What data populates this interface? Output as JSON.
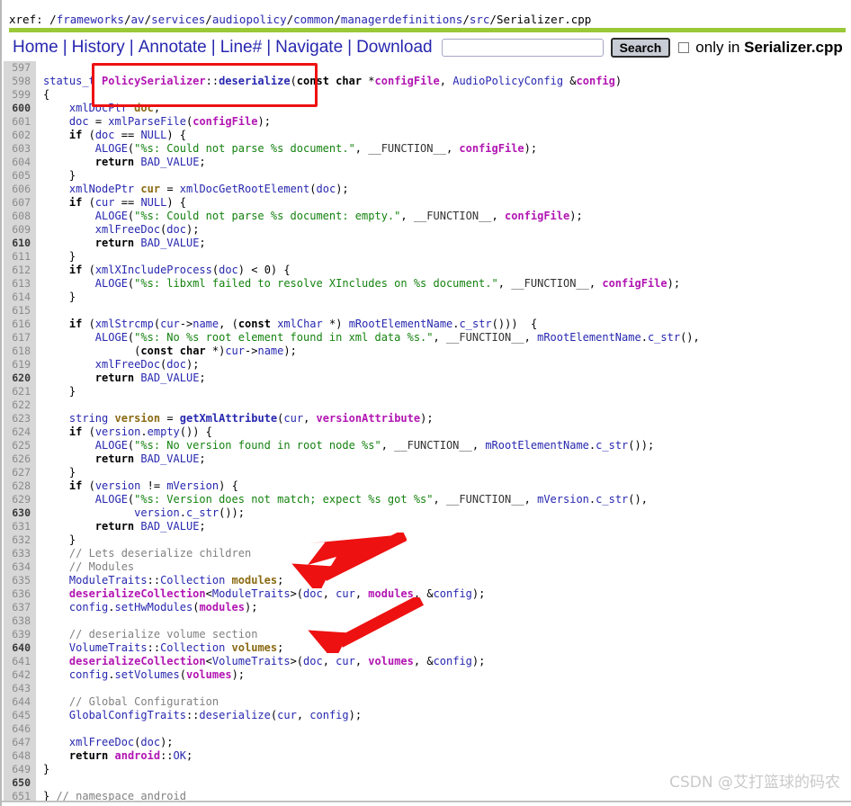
{
  "xref": {
    "label": "xref:",
    "segments": [
      {
        "text": "frameworks",
        "link": true
      },
      {
        "text": "av",
        "link": true
      },
      {
        "text": "services",
        "link": true
      },
      {
        "text": "audiopolicy",
        "link": true
      },
      {
        "text": "common",
        "link": true
      },
      {
        "text": "managerdefinitions",
        "link": true
      },
      {
        "text": "src",
        "link": true
      },
      {
        "text": "Serializer.cpp",
        "link": false
      }
    ]
  },
  "nav": {
    "links": [
      "Home",
      "History",
      "Annotate",
      "Line#",
      "Navigate",
      "Download"
    ],
    "separator": "|",
    "search_value": "",
    "search_placeholder": "",
    "search_button": "Search",
    "checkbox_checked": false,
    "only_in_prefix": "only in ",
    "only_in_file": "Serializer.cpp"
  },
  "colors": {
    "accent_green": "#9ac836",
    "link_blue": "#2727b0",
    "annotation_red": "#ee1111",
    "gutter_bg": "#d7d7d7",
    "string_green": "#14820f",
    "variable_magenta": "#b215b2",
    "decl_brown": "#8a6a12",
    "comment_gray": "#808080"
  },
  "code": {
    "first_line": 597,
    "lines": [
      {
        "n": 597,
        "html": ""
      },
      {
        "n": 598,
        "html": "<span class=\"typ\">status_t</span> <span class=\"cls\">PolicySerializer</span><span class=\"plain\">::</span><span class=\"fn\">deserialize</span><span class=\"plain\">(</span><span class=\"kw\">const char</span> <span class=\"plain\">*</span><span class=\"var\">configFile</span><span class=\"plain\">, </span><span class=\"typ\">AudioPolicyConfig</span> <span class=\"plain\">&amp;</span><span class=\"var\">config</span><span class=\"plain\">)</span>"
      },
      {
        "n": 599,
        "html": "<span class=\"plain\">{</span>"
      },
      {
        "n": 600,
        "html": "    <span class=\"typ\">xmlDocPtr</span> <span class=\"decl\">doc</span><span class=\"plain\">;</span>"
      },
      {
        "n": 601,
        "html": "    <span class=\"typ\">doc</span> <span class=\"plain\">= </span><span class=\"typ\">xmlParseFile</span><span class=\"plain\">(</span><span class=\"var\">configFile</span><span class=\"plain\">);</span>"
      },
      {
        "n": 602,
        "html": "    <span class=\"kw\">if</span> <span class=\"plain\">(</span><span class=\"typ\">doc</span> <span class=\"plain\">== </span><span class=\"typ\">NULL</span><span class=\"plain\">) {</span>"
      },
      {
        "n": 603,
        "html": "        <span class=\"typ\">ALOGE</span><span class=\"plain\">(</span><span class=\"str\">\"%s: Could not parse %s document.\"</span><span class=\"plain\">, </span><span class=\"mac\">__FUNCTION__</span><span class=\"plain\">, </span><span class=\"var\">configFile</span><span class=\"plain\">);</span>"
      },
      {
        "n": 604,
        "html": "        <span class=\"kw\">return</span> <span class=\"typ\">BAD_VALUE</span><span class=\"plain\">;</span>"
      },
      {
        "n": 605,
        "html": "    <span class=\"plain\">}</span>"
      },
      {
        "n": 606,
        "html": "    <span class=\"typ\">xmlNodePtr</span> <span class=\"decl\">cur</span> <span class=\"plain\">= </span><span class=\"typ\">xmlDocGetRootElement</span><span class=\"plain\">(</span><span class=\"typ\">doc</span><span class=\"plain\">);</span>"
      },
      {
        "n": 607,
        "html": "    <span class=\"kw\">if</span> <span class=\"plain\">(</span><span class=\"typ\">cur</span> <span class=\"plain\">== </span><span class=\"typ\">NULL</span><span class=\"plain\">) {</span>"
      },
      {
        "n": 608,
        "html": "        <span class=\"typ\">ALOGE</span><span class=\"plain\">(</span><span class=\"str\">\"%s: Could not parse %s document: empty.\"</span><span class=\"plain\">, </span><span class=\"mac\">__FUNCTION__</span><span class=\"plain\">, </span><span class=\"var\">configFile</span><span class=\"plain\">);</span>"
      },
      {
        "n": 609,
        "html": "        <span class=\"typ\">xmlFreeDoc</span><span class=\"plain\">(</span><span class=\"typ\">doc</span><span class=\"plain\">);</span>"
      },
      {
        "n": 610,
        "html": "        <span class=\"kw\">return</span> <span class=\"typ\">BAD_VALUE</span><span class=\"plain\">;</span>"
      },
      {
        "n": 611,
        "html": "    <span class=\"plain\">}</span>"
      },
      {
        "n": 612,
        "html": "    <span class=\"kw\">if</span> <span class=\"plain\">(</span><span class=\"typ\">xmlXIncludeProcess</span><span class=\"plain\">(</span><span class=\"typ\">doc</span><span class=\"plain\">) &lt; 0) {</span>"
      },
      {
        "n": 613,
        "html": "        <span class=\"typ\">ALOGE</span><span class=\"plain\">(</span><span class=\"str\">\"%s: libxml failed to resolve XIncludes on %s document.\"</span><span class=\"plain\">, </span><span class=\"mac\">__FUNCTION__</span><span class=\"plain\">, </span><span class=\"var\">configFile</span><span class=\"plain\">);</span>"
      },
      {
        "n": 614,
        "html": "    <span class=\"plain\">}</span>"
      },
      {
        "n": 615,
        "html": ""
      },
      {
        "n": 616,
        "html": "    <span class=\"kw\">if</span> <span class=\"plain\">(</span><span class=\"typ\">xmlStrcmp</span><span class=\"plain\">(</span><span class=\"typ\">cur</span><span class=\"plain\">-&gt;</span><span class=\"typ\">name</span><span class=\"plain\">, (</span><span class=\"kw\">const</span> <span class=\"typ\">xmlChar</span> <span class=\"plain\">*) </span><span class=\"typ\">mRootElementName</span><span class=\"plain\">.</span><span class=\"typ\">c_str</span><span class=\"plain\">()))  {</span>"
      },
      {
        "n": 617,
        "html": "        <span class=\"typ\">ALOGE</span><span class=\"plain\">(</span><span class=\"str\">\"%s: No %s root element found in xml data %s.\"</span><span class=\"plain\">, </span><span class=\"mac\">__FUNCTION__</span><span class=\"plain\">, </span><span class=\"typ\">mRootElementName</span><span class=\"plain\">.</span><span class=\"typ\">c_str</span><span class=\"plain\">(),</span>"
      },
      {
        "n": 618,
        "html": "              <span class=\"plain\">(</span><span class=\"kw\">const char</span> <span class=\"plain\">*)</span><span class=\"typ\">cur</span><span class=\"plain\">-&gt;</span><span class=\"typ\">name</span><span class=\"plain\">);</span>"
      },
      {
        "n": 619,
        "html": "        <span class=\"typ\">xmlFreeDoc</span><span class=\"plain\">(</span><span class=\"typ\">doc</span><span class=\"plain\">);</span>"
      },
      {
        "n": 620,
        "html": "        <span class=\"kw\">return</span> <span class=\"typ\">BAD_VALUE</span><span class=\"plain\">;</span>"
      },
      {
        "n": 621,
        "html": "    <span class=\"plain\">}</span>"
      },
      {
        "n": 622,
        "html": ""
      },
      {
        "n": 623,
        "html": "    <span class=\"typ\">string</span> <span class=\"decl\">version</span> <span class=\"plain\">= </span><span class=\"fn\">getXmlAttribute</span><span class=\"plain\">(</span><span class=\"typ\">cur</span><span class=\"plain\">, </span><span class=\"var\">versionAttribute</span><span class=\"plain\">);</span>"
      },
      {
        "n": 624,
        "html": "    <span class=\"kw\">if</span> <span class=\"plain\">(</span><span class=\"typ\">version</span><span class=\"plain\">.</span><span class=\"typ\">empty</span><span class=\"plain\">()) {</span>"
      },
      {
        "n": 625,
        "html": "        <span class=\"typ\">ALOGE</span><span class=\"plain\">(</span><span class=\"str\">\"%s: No version found in root node %s\"</span><span class=\"plain\">, </span><span class=\"mac\">__FUNCTION__</span><span class=\"plain\">, </span><span class=\"typ\">mRootElementName</span><span class=\"plain\">.</span><span class=\"typ\">c_str</span><span class=\"plain\">());</span>"
      },
      {
        "n": 626,
        "html": "        <span class=\"kw\">return</span> <span class=\"typ\">BAD_VALUE</span><span class=\"plain\">;</span>"
      },
      {
        "n": 627,
        "html": "    <span class=\"plain\">}</span>"
      },
      {
        "n": 628,
        "html": "    <span class=\"kw\">if</span> <span class=\"plain\">(</span><span class=\"typ\">version</span> <span class=\"plain\">!= </span><span class=\"typ\">mVersion</span><span class=\"plain\">) {</span>"
      },
      {
        "n": 629,
        "html": "        <span class=\"typ\">ALOGE</span><span class=\"plain\">(</span><span class=\"str\">\"%s: Version does not match; expect %s got %s\"</span><span class=\"plain\">, </span><span class=\"mac\">__FUNCTION__</span><span class=\"plain\">, </span><span class=\"typ\">mVersion</span><span class=\"plain\">.</span><span class=\"typ\">c_str</span><span class=\"plain\">(),</span>"
      },
      {
        "n": 630,
        "html": "              <span class=\"typ\">version</span><span class=\"plain\">.</span><span class=\"typ\">c_str</span><span class=\"plain\">());</span>"
      },
      {
        "n": 631,
        "html": "        <span class=\"kw\">return</span> <span class=\"typ\">BAD_VALUE</span><span class=\"plain\">;</span>"
      },
      {
        "n": 632,
        "html": "    <span class=\"plain\">}</span>"
      },
      {
        "n": 633,
        "html": "    <span class=\"cmt\">// Lets deserialize children</span>"
      },
      {
        "n": 634,
        "html": "    <span class=\"cmt\">// Modules</span>"
      },
      {
        "n": 635,
        "html": "    <span class=\"typ\">ModuleTraits</span><span class=\"plain\">::</span><span class=\"typ\">Collection</span> <span class=\"decl\">modules</span><span class=\"plain\">;</span>"
      },
      {
        "n": 636,
        "html": "    <span class=\"var\">deserializeCollection</span><span class=\"plain\">&lt;</span><span class=\"typ\">ModuleTraits</span><span class=\"plain\">&gt;(</span><span class=\"typ\">doc</span><span class=\"plain\">, </span><span class=\"typ\">cur</span><span class=\"plain\">, </span><span class=\"var\">modules</span><span class=\"plain\">, &amp;</span><span class=\"typ\">config</span><span class=\"plain\">);</span>"
      },
      {
        "n": 637,
        "html": "    <span class=\"typ\">config</span><span class=\"plain\">.</span><span class=\"typ\">setHwModules</span><span class=\"plain\">(</span><span class=\"var\">modules</span><span class=\"plain\">);</span>"
      },
      {
        "n": 638,
        "html": ""
      },
      {
        "n": 639,
        "html": "    <span class=\"cmt\">// deserialize volume section</span>"
      },
      {
        "n": 640,
        "html": "    <span class=\"typ\">VolumeTraits</span><span class=\"plain\">::</span><span class=\"typ\">Collection</span> <span class=\"decl\">volumes</span><span class=\"plain\">;</span>"
      },
      {
        "n": 641,
        "html": "    <span class=\"var\">deserializeCollection</span><span class=\"plain\">&lt;</span><span class=\"typ\">VolumeTraits</span><span class=\"plain\">&gt;(</span><span class=\"typ\">doc</span><span class=\"plain\">, </span><span class=\"typ\">cur</span><span class=\"plain\">, </span><span class=\"var\">volumes</span><span class=\"plain\">, &amp;</span><span class=\"typ\">config</span><span class=\"plain\">);</span>"
      },
      {
        "n": 642,
        "html": "    <span class=\"typ\">config</span><span class=\"plain\">.</span><span class=\"typ\">setVolumes</span><span class=\"plain\">(</span><span class=\"var\">volumes</span><span class=\"plain\">);</span>"
      },
      {
        "n": 643,
        "html": ""
      },
      {
        "n": 644,
        "html": "    <span class=\"cmt\">// Global Configuration</span>"
      },
      {
        "n": 645,
        "html": "    <span class=\"typ\">GlobalConfigTraits</span><span class=\"plain\">::</span><span class=\"typ\">deserialize</span><span class=\"plain\">(</span><span class=\"typ\">cur</span><span class=\"plain\">, </span><span class=\"typ\">config</span><span class=\"plain\">);</span>"
      },
      {
        "n": 646,
        "html": ""
      },
      {
        "n": 647,
        "html": "    <span class=\"typ\">xmlFreeDoc</span><span class=\"plain\">(</span><span class=\"typ\">doc</span><span class=\"plain\">);</span>"
      },
      {
        "n": 648,
        "html": "    <span class=\"kw\">return</span> <span class=\"var\">android</span><span class=\"plain\">::</span><span class=\"typ\">OK</span><span class=\"plain\">;</span>"
      },
      {
        "n": 649,
        "html": "<span class=\"plain\">}</span>"
      },
      {
        "n": 650,
        "html": ""
      },
      {
        "n": 651,
        "html": "<span class=\"plain\">} </span><span class=\"cmt\">// namespace android</span>"
      }
    ]
  },
  "annotations": {
    "highlight_box_target": "PolicySerializer::deserialize",
    "arrows": [
      {
        "name": "arrow-to-modules-collection",
        "points_to_line": 635
      },
      {
        "name": "arrow-to-volumes-collection",
        "points_to_line": 640
      }
    ]
  },
  "watermark": {
    "text": "CSDN @艾打篮球的码农"
  }
}
